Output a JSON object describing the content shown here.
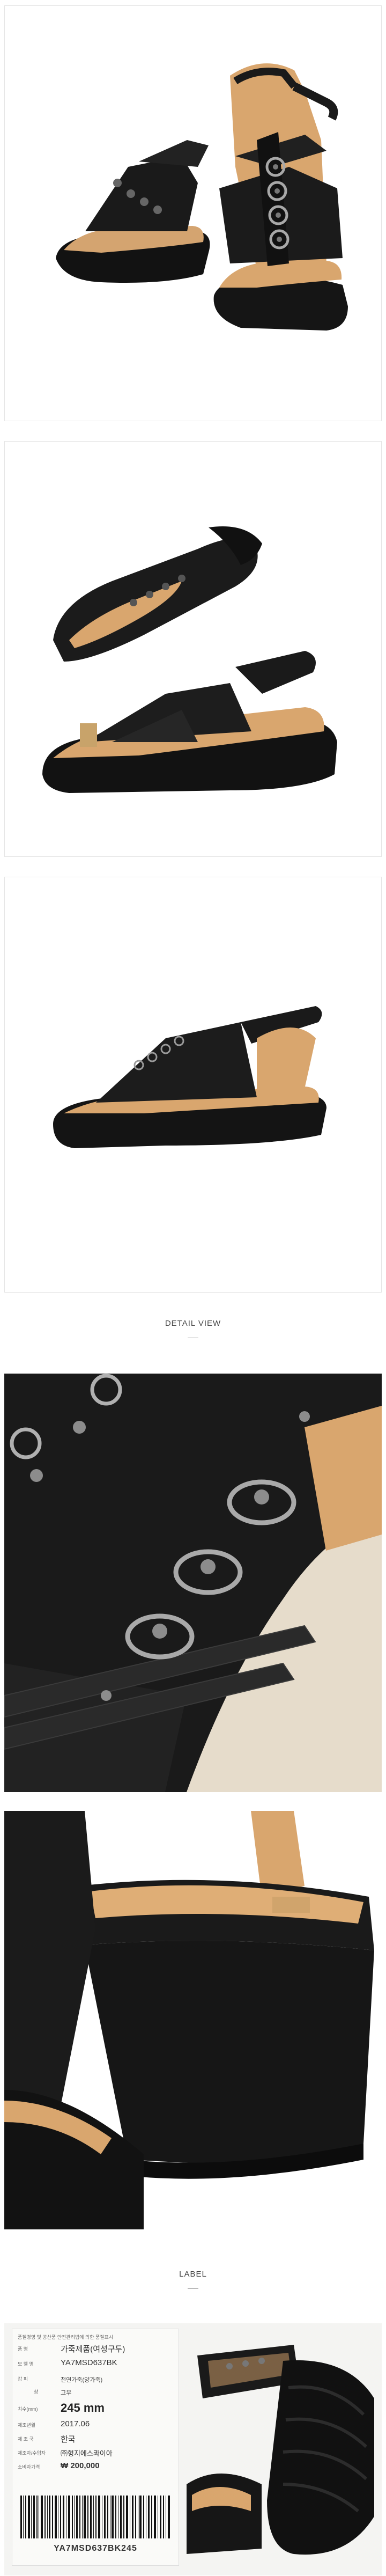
{
  "sections": {
    "detail_title": "DETAIL VIEW",
    "label_title": "LABEL"
  },
  "label": {
    "header_note": "품질경영 및 공산품 안전관리법에 의한 품질표시",
    "rows": [
      {
        "key": "품    명",
        "value": "가죽제품(여성구두)"
      },
      {
        "key": "모 델 명",
        "value": "YA7MSD637BK"
      },
      {
        "key": "갑    피",
        "value": "천연가죽(양가죽)"
      },
      {
        "key": "창",
        "value": "고무"
      }
    ],
    "size_key": "치수(mm)",
    "size_value": "245 mm",
    "date_key": "제조년월",
    "date_value": "2017.06",
    "country_key": "제 조 국",
    "country_value": "한국",
    "maker_key": "제조자/수입자",
    "maker_value": "㈜형지에스콰이아",
    "price_key": "소비자가격",
    "price_value": "₩ 200,000",
    "barcode_text": "YA7MSD637BK245"
  },
  "colors": {
    "leather": "#1c1c1c",
    "insole": "#d9a66e",
    "sole": "#151515",
    "metal": "#a8a8a8"
  }
}
